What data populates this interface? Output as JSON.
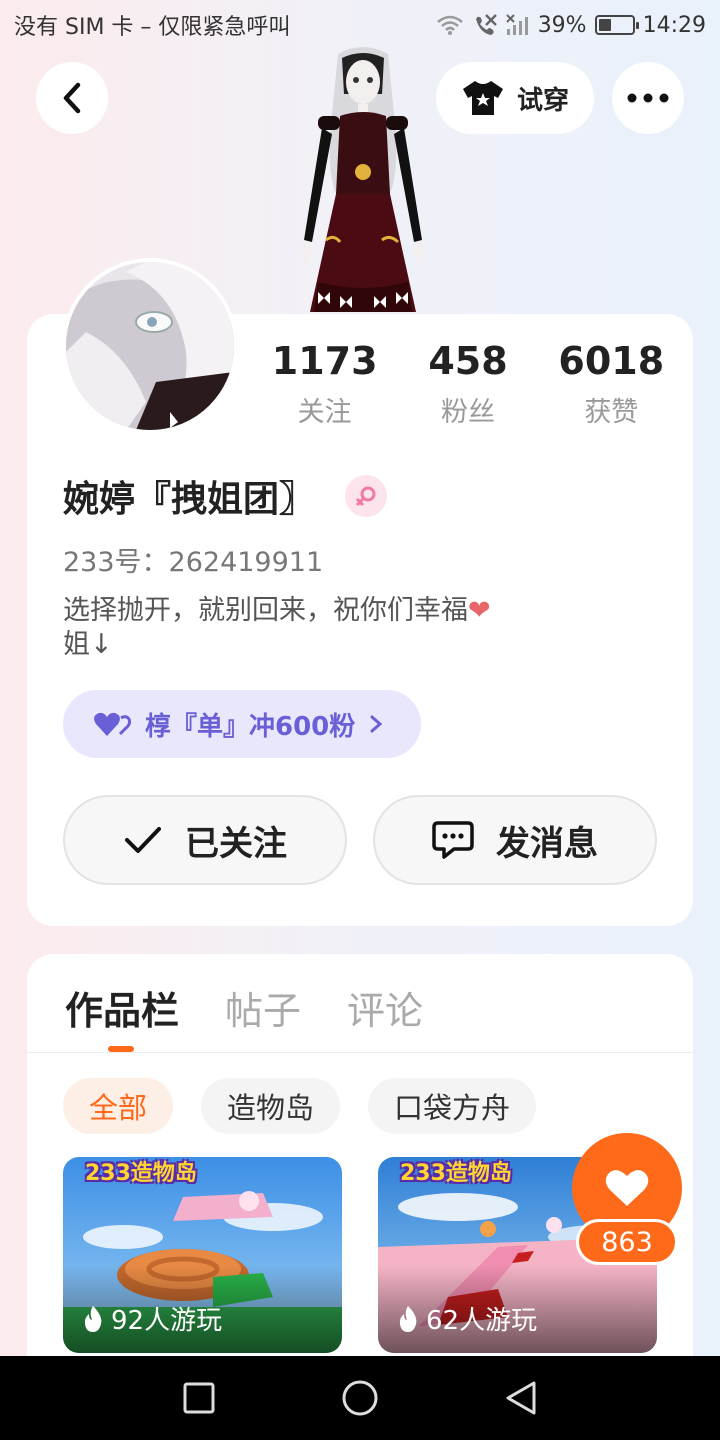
{
  "status_bar": {
    "carrier": "没有 SIM 卡 – 仅限紧急呼叫",
    "battery": "39%",
    "time": "14:29"
  },
  "header": {
    "try_on_label": "试穿"
  },
  "profile": {
    "stats": [
      {
        "value": "1173",
        "label": "关注"
      },
      {
        "value": "458",
        "label": "粉丝"
      },
      {
        "value": "6018",
        "label": "获赞"
      }
    ],
    "username": "婉婷『拽姐团〗",
    "id_text": "233号：262419911",
    "bio_line1": "选择抛开，就别回来，祝你们幸福",
    "bio_heart": "❤",
    "bio_line2": "姐↓",
    "pill_label": "椁『单』冲600粉",
    "follow_label": "已关注",
    "message_label": "发消息"
  },
  "works": {
    "tabs": [
      "作品栏",
      "帖子",
      "评论"
    ],
    "chips": [
      "全部",
      "造物岛",
      "口袋方舟"
    ],
    "games": [
      {
        "logo": "233造物岛",
        "plays": "92人游玩"
      },
      {
        "logo": "233造物岛",
        "plays": "62人游玩"
      }
    ]
  },
  "like": {
    "count": "863"
  },
  "colors": {
    "accent": "#ff6a1a",
    "pill_text": "#6a5fd6"
  }
}
